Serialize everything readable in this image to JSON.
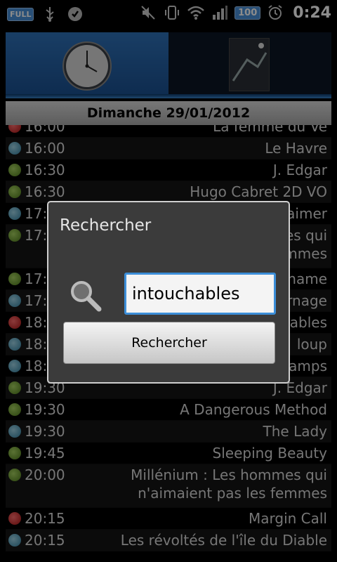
{
  "status_bar": {
    "battery_badge": "FULL",
    "battery_level": "100",
    "time": "0:24",
    "icons": [
      "usb-icon",
      "skype-icon",
      "mute-icon",
      "vibrate-icon",
      "wifi-icon",
      "signal-icon",
      "alarm-icon"
    ]
  },
  "date_header": "Dimanche 29/01/2012",
  "schedule": [
    {
      "time": "16:00",
      "title": "La femme du Ve",
      "color": "red"
    },
    {
      "time": "16:00",
      "title": "Le Havre",
      "color": "blue"
    },
    {
      "time": "16:30",
      "title": "J. Edgar",
      "color": "green"
    },
    {
      "time": "16:30",
      "title": "Hugo Cabret 2D VO",
      "color": "green"
    },
    {
      "time": "17:",
      "title": "aimer",
      "color": "blue"
    },
    {
      "time": "17:",
      "title": "es qui\nmmes",
      "color": "green"
    },
    {
      "time": "17:",
      "title": "name",
      "color": "green"
    },
    {
      "time": "17:",
      "title": "rnage",
      "color": "blue"
    },
    {
      "time": "18:",
      "title": "ables",
      "color": "red"
    },
    {
      "time": "18:",
      "title": "loup",
      "color": "blue"
    },
    {
      "time": "18:",
      "title": "amps",
      "color": "blue"
    },
    {
      "time": "19:30",
      "title": "J. Edgar",
      "color": "green"
    },
    {
      "time": "19:30",
      "title": "A Dangerous Method",
      "color": "green"
    },
    {
      "time": "19:30",
      "title": "The Lady",
      "color": "blue"
    },
    {
      "time": "19:45",
      "title": "Sleeping Beauty",
      "color": "green"
    },
    {
      "time": "20:00",
      "title": "Millénium : Les hommes qui\nn'aimaient pas les femmes",
      "color": "green"
    },
    {
      "time": "20:15",
      "title": "Margin Call",
      "color": "red"
    },
    {
      "time": "20:15",
      "title": "Les révoltés de l'île du Diable",
      "color": "blue"
    }
  ],
  "dialog": {
    "title": "Rechercher",
    "input_value": "intouchables",
    "button_label": "Rechercher"
  },
  "colors": {
    "accent": "#3c8ed8",
    "dot_green": "#7fb03a",
    "dot_blue": "#4aa0c4",
    "dot_red": "#d62020"
  }
}
